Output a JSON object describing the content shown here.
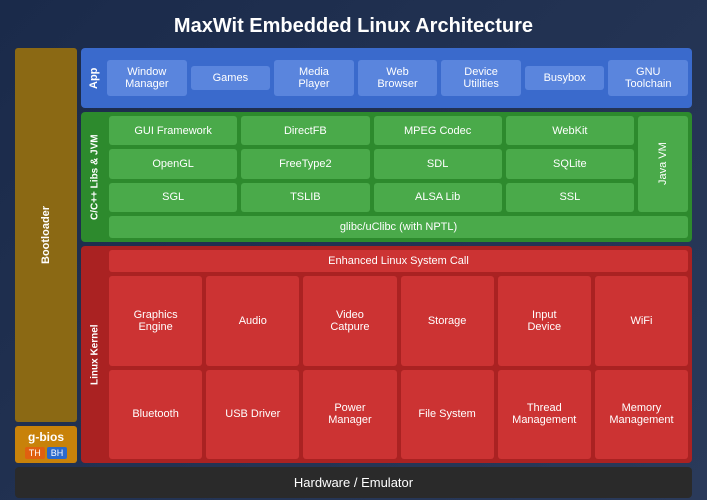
{
  "title": "MaxWit Embedded Linux Architecture",
  "app_layer": {
    "label": "App",
    "items": [
      {
        "id": "window-manager",
        "text": "Window\nManager"
      },
      {
        "id": "games",
        "text": "Games"
      },
      {
        "id": "media-player",
        "text": "Media\nPlayer"
      },
      {
        "id": "web-browser",
        "text": "Web\nBrowser"
      },
      {
        "id": "device-utilities",
        "text": "Device\nUtilities"
      },
      {
        "id": "busybox",
        "text": "Busybox"
      },
      {
        "id": "gnu-toolchain",
        "text": "GNU\nToolchain"
      }
    ]
  },
  "libs_layer": {
    "label": "C/C++ Libs & JVM",
    "row1": [
      {
        "id": "gui-framework",
        "text": "GUI Framework"
      },
      {
        "id": "directfb",
        "text": "DirectFB"
      },
      {
        "id": "mpeg-codec",
        "text": "MPEG Codec"
      },
      {
        "id": "webkit",
        "text": "WebKit"
      }
    ],
    "row2": [
      {
        "id": "opengl",
        "text": "OpenGL"
      },
      {
        "id": "freetype2",
        "text": "FreeType2"
      },
      {
        "id": "sdl",
        "text": "SDL"
      },
      {
        "id": "sqlite",
        "text": "SQLite"
      }
    ],
    "row3": [
      {
        "id": "sgl",
        "text": "SGL"
      },
      {
        "id": "tslib",
        "text": "TSLIB"
      },
      {
        "id": "alsa-lib",
        "text": "ALSA Lib"
      },
      {
        "id": "ssl",
        "text": "SSL"
      }
    ],
    "javavm": "Java VM",
    "glibc": "glibc/uClibc (with NPTL)"
  },
  "kernel_layer": {
    "label": "Linux Kernel",
    "enhanced": "Enhanced Linux System Call",
    "row1": [
      {
        "id": "graphics-engine",
        "text": "Graphics\nEngine"
      },
      {
        "id": "audio",
        "text": "Audio"
      },
      {
        "id": "video-capture",
        "text": "Video\nCatpure"
      },
      {
        "id": "storage",
        "text": "Storage"
      },
      {
        "id": "input-device",
        "text": "Input\nDevice"
      },
      {
        "id": "wifi",
        "text": "WiFi"
      }
    ],
    "row2": [
      {
        "id": "bluetooth",
        "text": "Bluetooth"
      },
      {
        "id": "usb-driver",
        "text": "USB Driver"
      },
      {
        "id": "power-manager",
        "text": "Power\nManager"
      },
      {
        "id": "file-system",
        "text": "File System"
      },
      {
        "id": "thread-management",
        "text": "Thread\nManagement"
      },
      {
        "id": "memory-management",
        "text": "Memory\nManagement"
      }
    ]
  },
  "bootloader": {
    "label": "Bootloader",
    "gbios": "g-bios",
    "badge1": "TH",
    "badge2": "BH"
  },
  "hardware": "Hardware / Emulator"
}
